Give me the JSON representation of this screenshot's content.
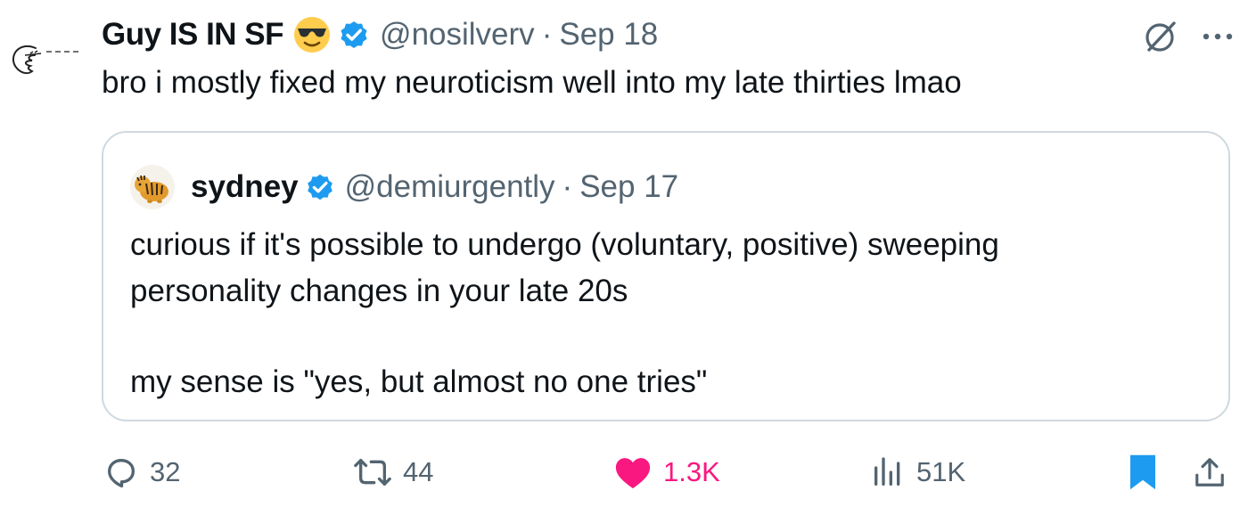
{
  "tweet": {
    "author": {
      "name": "Guy IS IN SF",
      "emoji": "sunglasses-face",
      "verified": true,
      "handle": "@nosilverv",
      "date": "Sep 18"
    },
    "text": "bro i mostly fixed my neuroticism well into my late thirties lmao",
    "quote": {
      "author": {
        "name": "sydney",
        "verified": true,
        "handle": "@demiurgently",
        "date": "Sep 17"
      },
      "lines": [
        "curious if it's possible to undergo (voluntary, positive) sweeping",
        "personality changes in your late 20s",
        "my sense is \"yes, but almost no one tries\""
      ]
    },
    "actions": {
      "replies": "32",
      "reposts": "44",
      "likes": "1.3K",
      "views": "51K"
    },
    "separator": "·"
  },
  "colors": {
    "verified": "#1d9bf0",
    "like": "#f91880",
    "bookmark": "#1d9bf0",
    "muted": "#536471"
  },
  "icons": [
    "reply-icon",
    "repost-icon",
    "heart-icon",
    "views-icon",
    "bookmark-icon",
    "share-icon",
    "grok-icon",
    "more-icon",
    "verified-badge-icon"
  ]
}
